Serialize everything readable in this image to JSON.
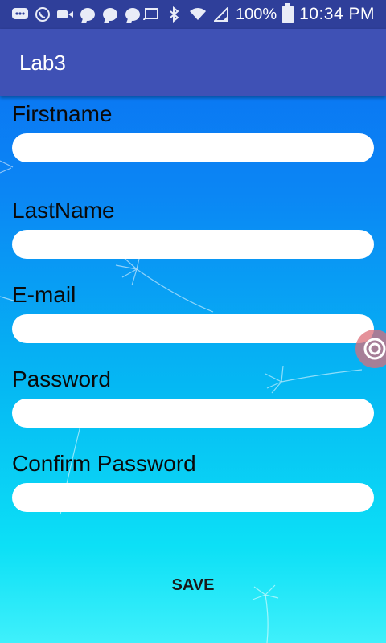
{
  "status_bar": {
    "battery": "100%",
    "time": "10:34 PM",
    "icons": [
      "messenger-icon",
      "viber-icon",
      "video-icon",
      "chat-icon",
      "chat-icon",
      "chat-icon",
      "cast-icon",
      "bluetooth-icon",
      "wifi-icon",
      "signal-icon",
      "battery-icon"
    ]
  },
  "app_bar": {
    "title": "Lab3"
  },
  "form": {
    "firstname_label": "Firstname",
    "lastname_label": "LastName",
    "email_label": "E-mail",
    "password_label": "Password",
    "confirm_password_label": "Confirm Password",
    "firstname_value": "",
    "lastname_value": "",
    "email_value": "",
    "password_value": "",
    "confirm_password_value": "",
    "save_label": "SAVE"
  },
  "colors": {
    "status_bar": "#2f3f9a",
    "app_bar": "#3f51b5",
    "background_top": "#0a6cf2",
    "background_bottom": "#3ff0fb"
  }
}
